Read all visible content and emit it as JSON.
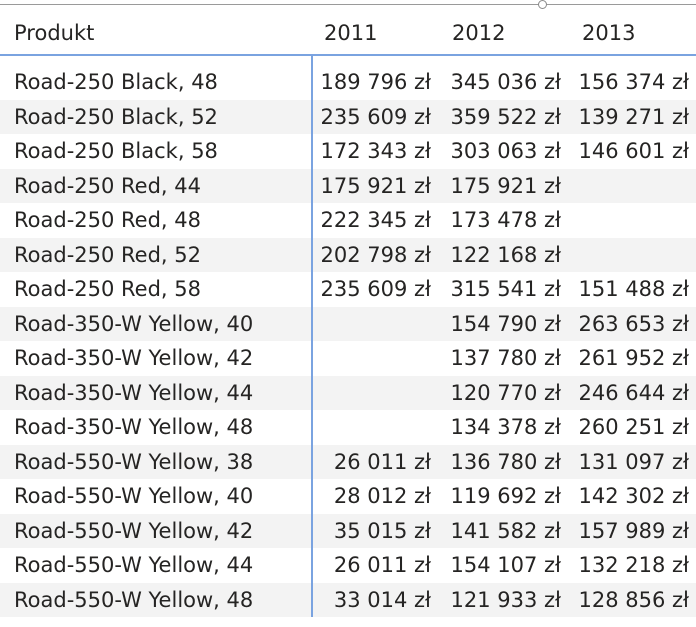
{
  "table": {
    "columns": [
      "Produkt",
      "2011",
      "2012",
      "2013"
    ],
    "rows": [
      {
        "product": "Road-250 Black, 48",
        "y2011": "189 796 zł",
        "y2012": "345 036 zł",
        "y2013": "156 374 zł"
      },
      {
        "product": "Road-250 Black, 52",
        "y2011": "235 609 zł",
        "y2012": "359 522 zł",
        "y2013": "139 271 zł"
      },
      {
        "product": "Road-250 Black, 58",
        "y2011": "172 343 zł",
        "y2012": "303 063 zł",
        "y2013": "146 601 zł"
      },
      {
        "product": "Road-250 Red, 44",
        "y2011": "175 921 zł",
        "y2012": "175 921 zł",
        "y2013": ""
      },
      {
        "product": "Road-250 Red, 48",
        "y2011": "222 345 zł",
        "y2012": "173 478 zł",
        "y2013": ""
      },
      {
        "product": "Road-250 Red, 52",
        "y2011": "202 798 zł",
        "y2012": "122 168 zł",
        "y2013": ""
      },
      {
        "product": "Road-250 Red, 58",
        "y2011": "235 609 zł",
        "y2012": "315 541 zł",
        "y2013": "151 488 zł"
      },
      {
        "product": "Road-350-W Yellow, 40",
        "y2011": "",
        "y2012": "154 790 zł",
        "y2013": "263 653 zł"
      },
      {
        "product": "Road-350-W Yellow, 42",
        "y2011": "",
        "y2012": "137 780 zł",
        "y2013": "261 952 zł"
      },
      {
        "product": "Road-350-W Yellow, 44",
        "y2011": "",
        "y2012": "120 770 zł",
        "y2013": "246 644 zł"
      },
      {
        "product": "Road-350-W Yellow, 48",
        "y2011": "",
        "y2012": "134 378 zł",
        "y2013": "260 251 zł"
      },
      {
        "product": "Road-550-W Yellow, 38",
        "y2011": "26 011 zł",
        "y2012": "136 780 zł",
        "y2013": "131 097 zł"
      },
      {
        "product": "Road-550-W Yellow, 40",
        "y2011": "28 012 zł",
        "y2012": "119 692 zł",
        "y2013": "142 302 zł"
      },
      {
        "product": "Road-550-W Yellow, 42",
        "y2011": "35 015 zł",
        "y2012": "141 582 zł",
        "y2013": "157 989 zł"
      },
      {
        "product": "Road-550-W Yellow, 44",
        "y2011": "26 011 zł",
        "y2012": "154 107 zł",
        "y2013": "132 218 zł"
      },
      {
        "product": "Road-550-W Yellow, 48",
        "y2011": "33 014 zł",
        "y2012": "121 933 zł",
        "y2013": "128 856 zł"
      }
    ]
  }
}
